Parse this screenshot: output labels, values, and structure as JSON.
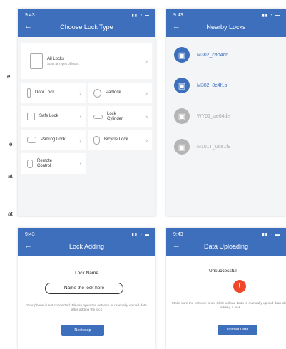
{
  "side_text": {
    "line1": "e.",
    "line2": "e",
    "line3": "at",
    "line4": "at"
  },
  "screen1": {
    "time": "9:43",
    "title": "Choose Lock Type",
    "all_locks": {
      "label": "All Locks",
      "sub": "Scan all types of locks"
    },
    "items": [
      {
        "label": "Door Lock"
      },
      {
        "label": "Padlock"
      },
      {
        "label": "Safe Lock"
      },
      {
        "label": "Lock Cylinder"
      },
      {
        "label": "Parking Lock"
      },
      {
        "label": "Bicycle Lock"
      },
      {
        "label": "Remote Control"
      }
    ]
  },
  "screen2": {
    "time": "9:43",
    "title": "Nearby Locks",
    "locks": [
      {
        "name": "M302_cab4c6",
        "active": true
      },
      {
        "name": "M302_8c4f1b",
        "active": true
      },
      {
        "name": "WY01_ae04de",
        "active": false
      },
      {
        "name": "M101T_0de1f9",
        "active": false
      }
    ],
    "colors": {
      "active": "#3d6fbd",
      "inactive": "#b5b5b5"
    }
  },
  "screen3": {
    "time": "9:43",
    "title": "Lock Adding",
    "field_label": "Lock Name",
    "input_placeholder": "Name the lock here",
    "note": "Your phone is not connected. Please open the network or manually upload data after adding the lock",
    "button": "Next step"
  },
  "screen4": {
    "time": "9:43",
    "title": "Data Uploading",
    "status": "Unsuccessful",
    "error_icon": "!",
    "note": "Make sure the network is ok. Click Upload Data to manually upload data after adding a lock",
    "button": "Upload Data"
  },
  "icons": {
    "back": "←",
    "chevron": "›",
    "status": "▮▮ ◔ ▬"
  }
}
